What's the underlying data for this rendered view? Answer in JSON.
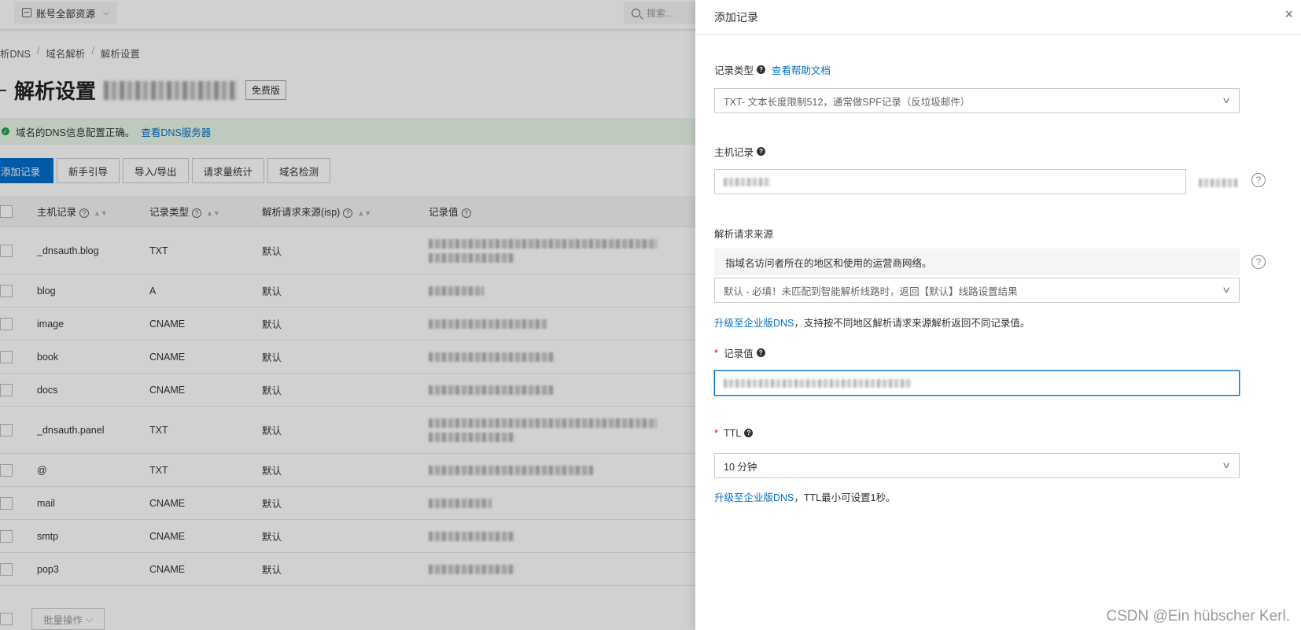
{
  "topbar": {
    "resource_select": "账号全部资源",
    "search_placeholder": "搜索..."
  },
  "breadcrumb": [
    "析DNS",
    "域名解析",
    "解析设置"
  ],
  "page": {
    "title": "解析设置",
    "badge": "免费版"
  },
  "alert": {
    "text": "域名的DNS信息配置正确。",
    "link": "查看DNS服务器"
  },
  "toolbar": {
    "add": "添加记录",
    "guide": "新手引导",
    "import_export": "导入/导出",
    "stats": "请求量统计",
    "check": "域名检测"
  },
  "table": {
    "headers": {
      "host": "主机记录",
      "type": "记录类型",
      "isp": "解析请求来源(isp)",
      "value": "记录值"
    },
    "rows": [
      {
        "host": "_dnsauth.blog",
        "type": "TXT",
        "isp": "默认"
      },
      {
        "host": "blog",
        "type": "A",
        "isp": "默认"
      },
      {
        "host": "image",
        "type": "CNAME",
        "isp": "默认"
      },
      {
        "host": "book",
        "type": "CNAME",
        "isp": "默认"
      },
      {
        "host": "docs",
        "type": "CNAME",
        "isp": "默认"
      },
      {
        "host": "_dnsauth.panel",
        "type": "TXT",
        "isp": "默认"
      },
      {
        "host": "@",
        "type": "TXT",
        "isp": "默认"
      },
      {
        "host": "mail",
        "type": "CNAME",
        "isp": "默认"
      },
      {
        "host": "smtp",
        "type": "CNAME",
        "isp": "默认"
      },
      {
        "host": "pop3",
        "type": "CNAME",
        "isp": "默认"
      }
    ],
    "bulk_action": "批量操作"
  },
  "drawer": {
    "title": "添加记录",
    "close": "×",
    "record_type_label": "记录类型",
    "help_doc_link": "查看帮助文档",
    "record_type_value": "TXT- 文本长度限制512，通常做SPF记录（反垃圾邮件）",
    "host_label": "主机记录",
    "source_label": "解析请求来源",
    "source_info": "指域名访问者所在的地区和使用的运营商网络。",
    "source_value": "默认 - 必填！未匹配到智能解析线路时，返回【默认】线路设置结果",
    "source_hint_link": "升级至企业版DNS",
    "source_hint_text": "，支持按不同地区解析请求来源解析返回不同记录值。",
    "value_label": "记录值",
    "ttl_label": "TTL",
    "ttl_value": "10 分钟",
    "ttl_hint_link": "升级至企业版DNS",
    "ttl_hint_text": "，TTL最小可设置1秒。"
  },
  "watermark": "CSDN @Ein hübscher Kerl."
}
